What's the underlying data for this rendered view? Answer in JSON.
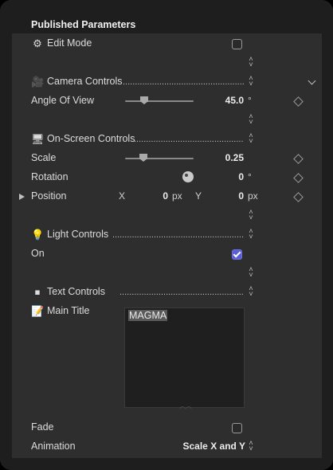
{
  "header": {
    "title": "Published Parameters"
  },
  "edit_mode": {
    "label": "Edit Mode",
    "icon": "gear-icon"
  },
  "camera": {
    "label": "Camera Controls",
    "icon": "camera-icon"
  },
  "angle_of_view": {
    "label": "Angle Of View",
    "value": "45.0",
    "unit": "°",
    "slider_fraction": 0.28
  },
  "onscreen": {
    "label": "On-Screen Controls",
    "icon": "monitor-icon"
  },
  "scale": {
    "label": "Scale",
    "value": "0.25",
    "slider_fraction": 0.25
  },
  "rotation": {
    "label": "Rotation",
    "value": "0",
    "unit": "°"
  },
  "position": {
    "label": "Position",
    "x_label": "X",
    "x_value": "0",
    "x_unit": "px",
    "y_label": "Y",
    "y_value": "0",
    "y_unit": "px"
  },
  "light": {
    "label": "Light Controls",
    "icon": "lightbulb-icon"
  },
  "on": {
    "label": "On",
    "checked": true
  },
  "text_controls": {
    "label": "Text Controls",
    "icon": "stop-square-icon"
  },
  "main_title": {
    "label": "Main Title",
    "icon": "notepad-icon",
    "value": "MAGMA"
  },
  "fade": {
    "label": "Fade",
    "checked": false
  },
  "animation": {
    "label": "Animation",
    "value": "Scale X and Y"
  },
  "icons": {
    "glyphs": {
      "gear": "⚙",
      "camera": "🎥",
      "monitor": "🖥",
      "lightbulb": "💡",
      "stop": "⏹",
      "notepad": "📝"
    }
  },
  "colors": {
    "accent": "#5b5fd6",
    "panel": "#2e2e2e",
    "frame": "#1e1e1e"
  }
}
